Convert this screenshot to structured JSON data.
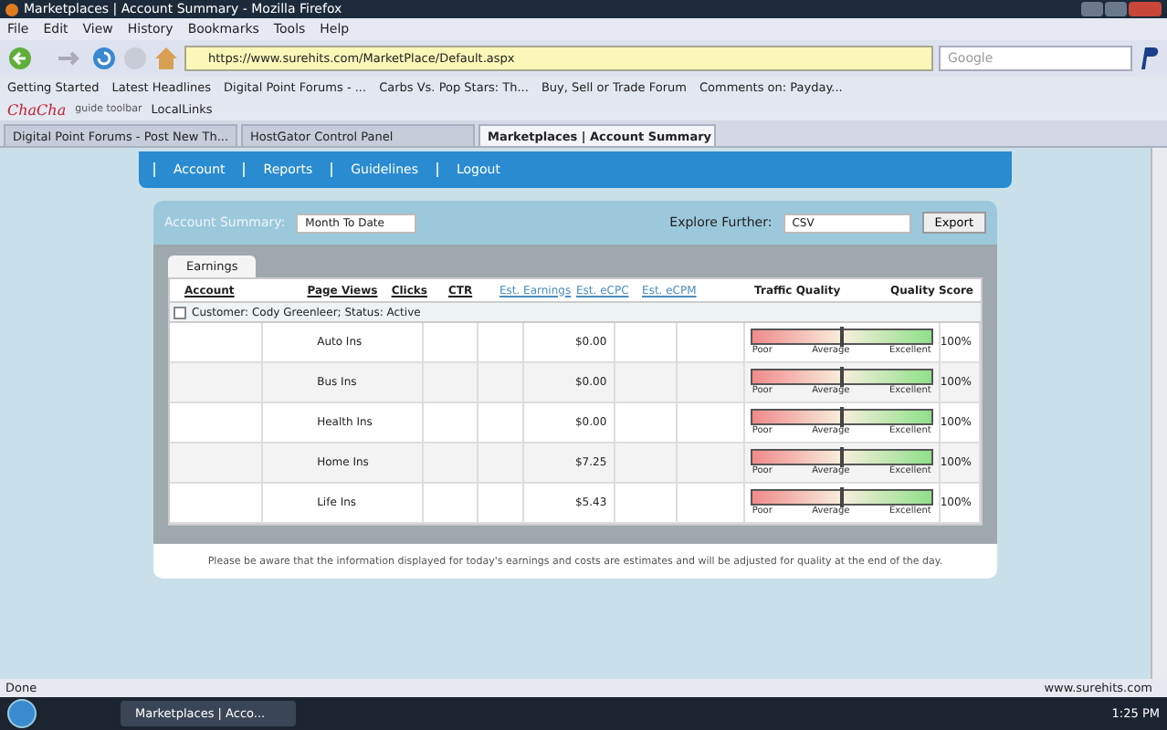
{
  "window": {
    "title": "Marketplaces | Account Summary - Mozilla Firefox"
  },
  "menu": [
    "File",
    "Edit",
    "View",
    "History",
    "Bookmarks",
    "Tools",
    "Help"
  ],
  "address": {
    "value": "https://www.surehits.com/MarketPlace/Default.aspx"
  },
  "search": {
    "placeholder": "Google"
  },
  "bookmarks": [
    "Getting Started",
    "Latest Headlines",
    "Digital Point Forums - ...",
    "Carbs Vs. Pop Stars: Th...",
    "Buy, Sell or Trade Forum",
    "Comments on: Payday..."
  ],
  "toolbar2": {
    "logo": "ChaCha",
    "caption": "guide toolbar",
    "link": "LocalLinks"
  },
  "tabs": [
    {
      "label": "Digital Point Forums - Post New Th...",
      "selected": false
    },
    {
      "label": "HostGator Control Panel",
      "selected": false
    },
    {
      "label": "Marketplaces | Account Summary",
      "selected": true
    }
  ],
  "nav": [
    "Account",
    "Reports",
    "Guidelines",
    "Logout"
  ],
  "summary": {
    "label": "Account Summary:",
    "period": "Month To Date",
    "explore_label": "Explore Further:",
    "format": "CSV",
    "export": "Export"
  },
  "panel_tab": "Earnings",
  "table": {
    "columns": [
      {
        "label": "Account",
        "link": false
      },
      {
        "label": "Page Views",
        "link": false
      },
      {
        "label": "Clicks",
        "link": false
      },
      {
        "label": "CTR",
        "link": false
      },
      {
        "label": "Est. Earnings",
        "link": true
      },
      {
        "label": "Est. eCPC",
        "link": true
      },
      {
        "label": "Est. eCPM",
        "link": true
      },
      {
        "label": "Traffic Quality",
        "link": false
      },
      {
        "label": "Quality Score",
        "link": false
      }
    ],
    "group": "Customer: Cody Greenleer; Status: Active",
    "rows": [
      {
        "product": "Auto Ins",
        "earnings": "$0.00",
        "level": 0.5,
        "gauge_labels": [
          "Poor",
          "Average",
          "Excellent"
        ],
        "score": "100%"
      },
      {
        "product": "Bus Ins",
        "earnings": "$0.00",
        "level": 0.5,
        "gauge_labels": [
          "Poor",
          "Average",
          "Excellent"
        ],
        "score": "100%"
      },
      {
        "product": "Health Ins",
        "earnings": "$0.00",
        "level": 0.5,
        "gauge_labels": [
          "Poor",
          "Average",
          "Excellent"
        ],
        "score": "100%"
      },
      {
        "product": "Home Ins",
        "earnings": "$7.25",
        "level": 0.5,
        "gauge_labels": [
          "Poor",
          "Average",
          "Excellent"
        ],
        "score": "100%"
      },
      {
        "product": "Life Ins",
        "earnings": "$5.43",
        "level": 0.5,
        "gauge_labels": [
          "Poor",
          "Average",
          "Excellent"
        ],
        "score": "100%"
      }
    ]
  },
  "note": "Please be aware that the information displayed for today's earnings and costs are estimates and will be adjusted for quality at the end of the day.",
  "status_bar": {
    "text": "Done",
    "site": "www.surehits.com"
  },
  "taskbar": {
    "window": "Marketplaces | Acco...",
    "time": "1:25 PM"
  }
}
